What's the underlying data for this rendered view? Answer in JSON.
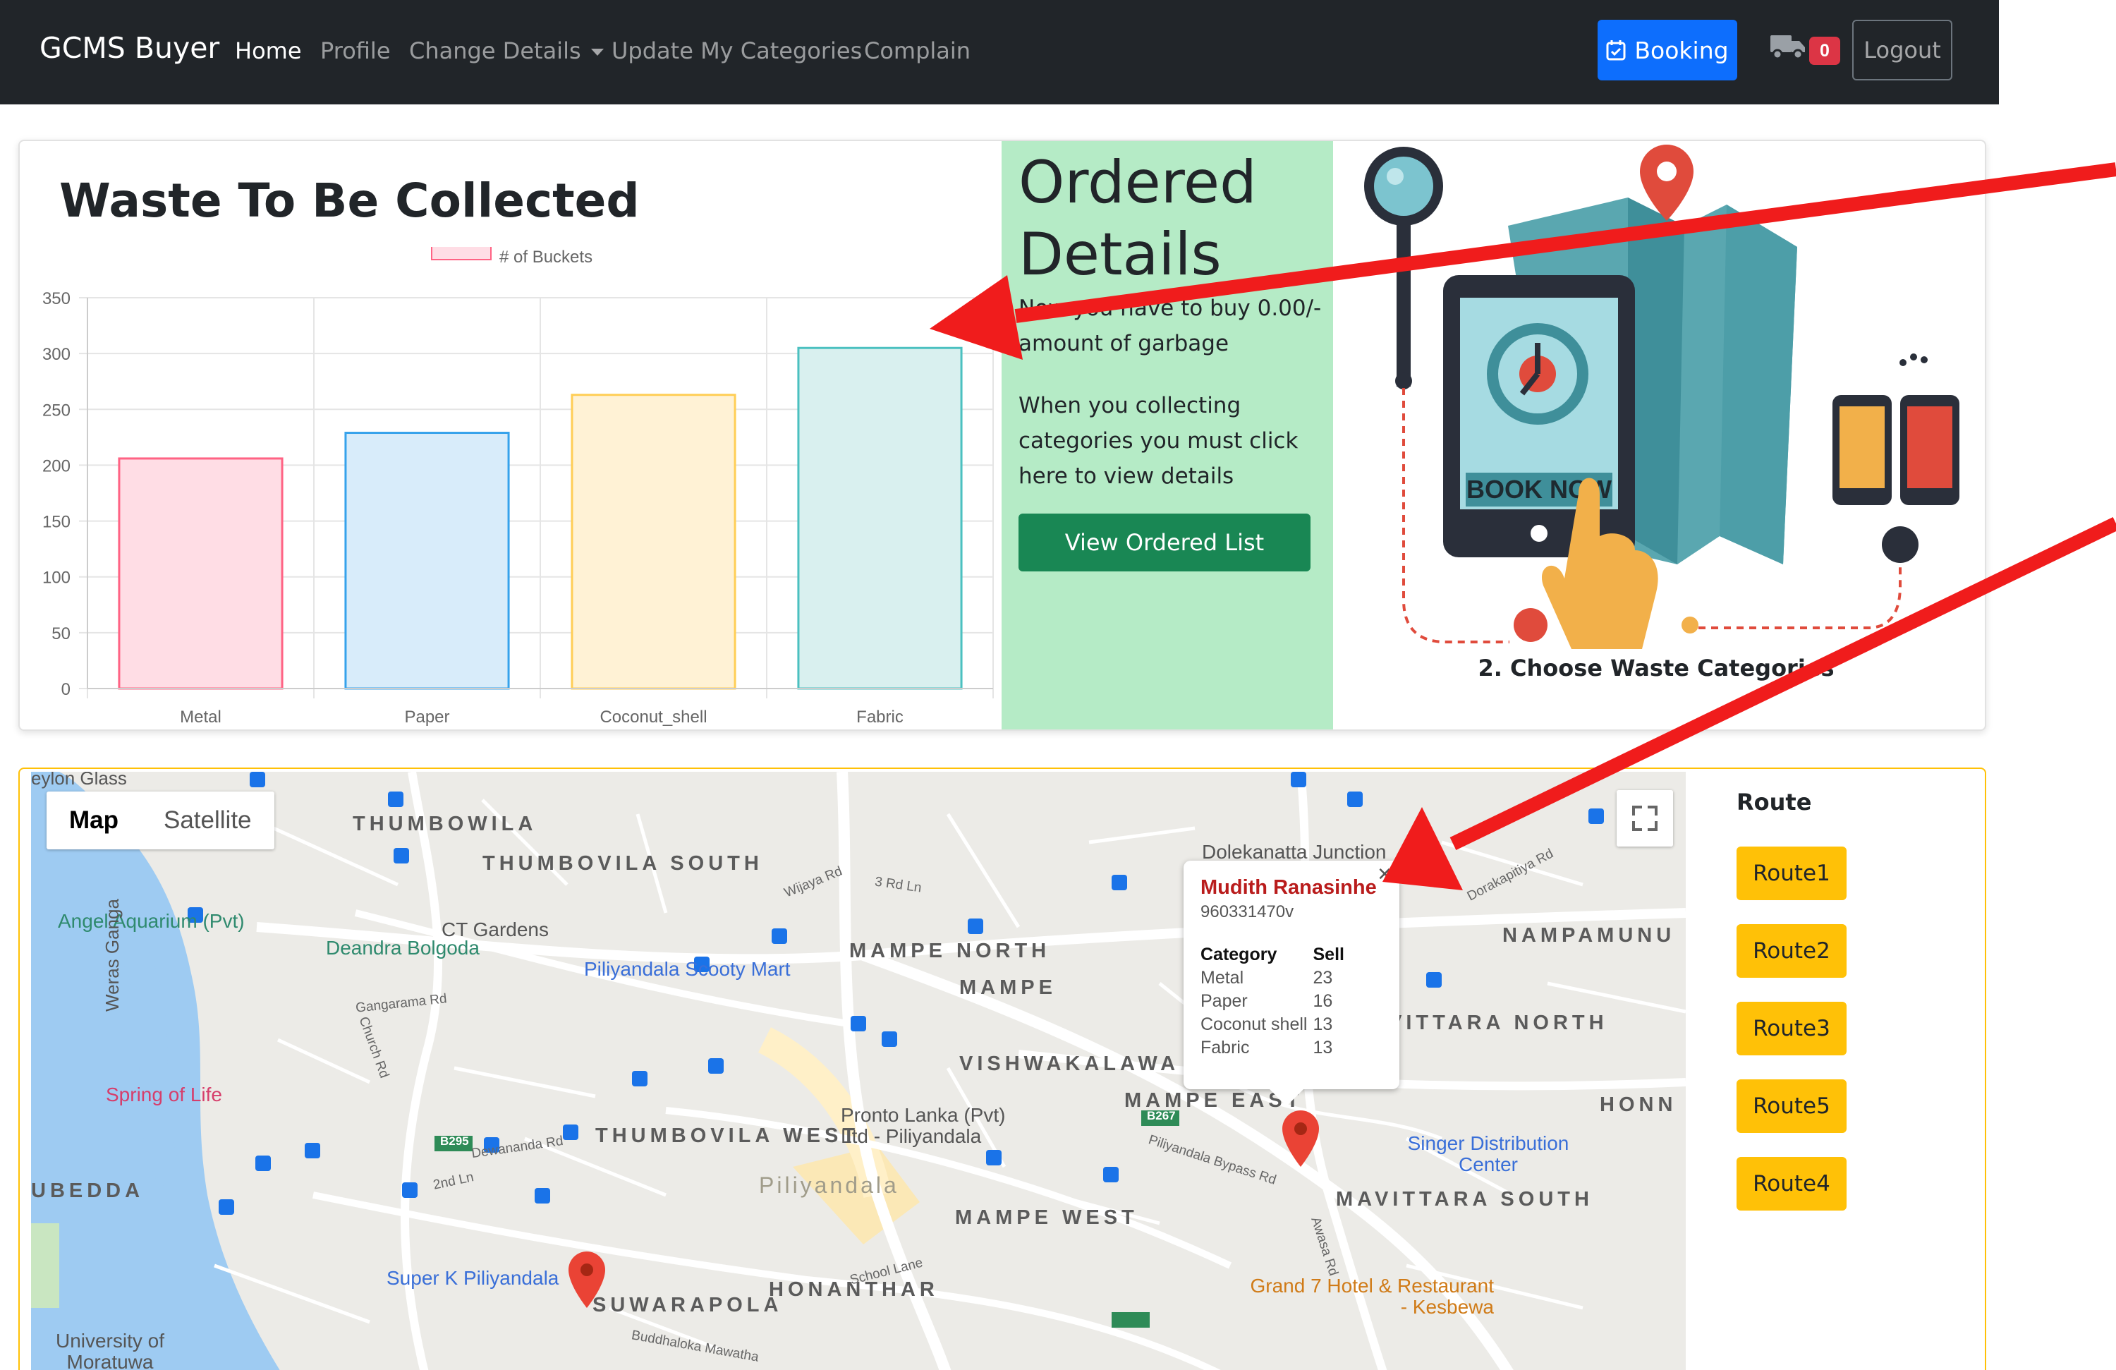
{
  "navbar": {
    "brand": "GCMS Buyer",
    "links": [
      "Home",
      "Profile",
      "Change Details",
      "Update My Categories",
      "Complain"
    ],
    "booking_label": "Booking",
    "cart_count": "0",
    "logout_label": "Logout"
  },
  "waste_card": {
    "title": "Waste To Be Collected"
  },
  "chart_data": {
    "type": "bar",
    "title": "",
    "legend": [
      "# of Buckets"
    ],
    "legend_position": "top",
    "categories": [
      "Metal",
      "Paper",
      "Coconut_shell",
      "Fabric"
    ],
    "series": [
      {
        "name": "# of Buckets",
        "values": [
          206,
          229,
          263,
          305
        ]
      }
    ],
    "colors": [
      "#ffdde5",
      "#d8ecfa",
      "#fff2d5",
      "#d9f0ef"
    ],
    "border_colors": [
      "#ff6384",
      "#36a2eb",
      "#ffce56",
      "#4bc0c0"
    ],
    "ylim": [
      0,
      350
    ],
    "yticks": [
      0,
      50,
      100,
      150,
      200,
      250,
      300,
      350
    ],
    "grid": true
  },
  "ordered_details": {
    "title": "Ordered Details",
    "text1": "Now you have to buy 0.00/- amount of garbage",
    "text2": "When you collecting categories you must click here to view details",
    "button_label": "View Ordered List"
  },
  "illustration": {
    "caption": "2. Choose Waste Categories",
    "sign_text": "BOOK NOW"
  },
  "map": {
    "type_map": "Map",
    "type_satellite": "Satellite",
    "areas": [
      "THUMBOWILA",
      "THUMBOVILA SOUTH",
      "MAMPE NORTH",
      "MAMPE",
      "VISHWAKALAWA",
      "NAMPAMUNU",
      "VITTARA NORTH",
      "MAMPE EAST",
      "THUMBOVILA WEST",
      "UBEDDA",
      "MAMPE WEST",
      "MAVITTARA SOUTH",
      "HONANTHAR",
      "SUWARAPOLA",
      "HONN"
    ],
    "pois": [
      "Angel Aquarium (Pvt)",
      "Deandra Bolgoda",
      "CT Gardens",
      "Piliyandala Scooty Mart",
      "Weras Ganga",
      "Spring of Life",
      "Pronto Lanka (Pvt) Ltd - Piliyandala",
      "Singer Distribution Center",
      "Grand 7 Hotel & Restaurant - Kesbewa",
      "Super K Piliyandala",
      "University of Moratuwa",
      "Piliyandala",
      "Dolekanatta Junction",
      "eylon Glass"
    ],
    "roads": [
      "Gangarama Rd",
      "Church Rd",
      "Dewananda Rd",
      "2nd Ln",
      "Piliyandala Bypass Rd",
      "Wijaya Rd",
      "3 Rd Ln",
      "School Lane",
      "Buddhaloka Mawatha",
      "Awasa Rd",
      "Dorakapitiya Rd",
      "B295",
      "B267"
    ],
    "info_window": {
      "name": "Mudith Ranasinhe",
      "id": "960331470v",
      "col_category": "Category",
      "col_sell": "Sell",
      "rows": [
        {
          "category": "Metal",
          "sell": "23"
        },
        {
          "category": "Paper",
          "sell": "16"
        },
        {
          "category": "Coconut shell",
          "sell": "13"
        },
        {
          "category": "Fabric",
          "sell": "13"
        }
      ]
    }
  },
  "routes": {
    "title": "Route",
    "buttons": [
      "Route1",
      "Route2",
      "Route3",
      "Route5",
      "Route4"
    ]
  }
}
